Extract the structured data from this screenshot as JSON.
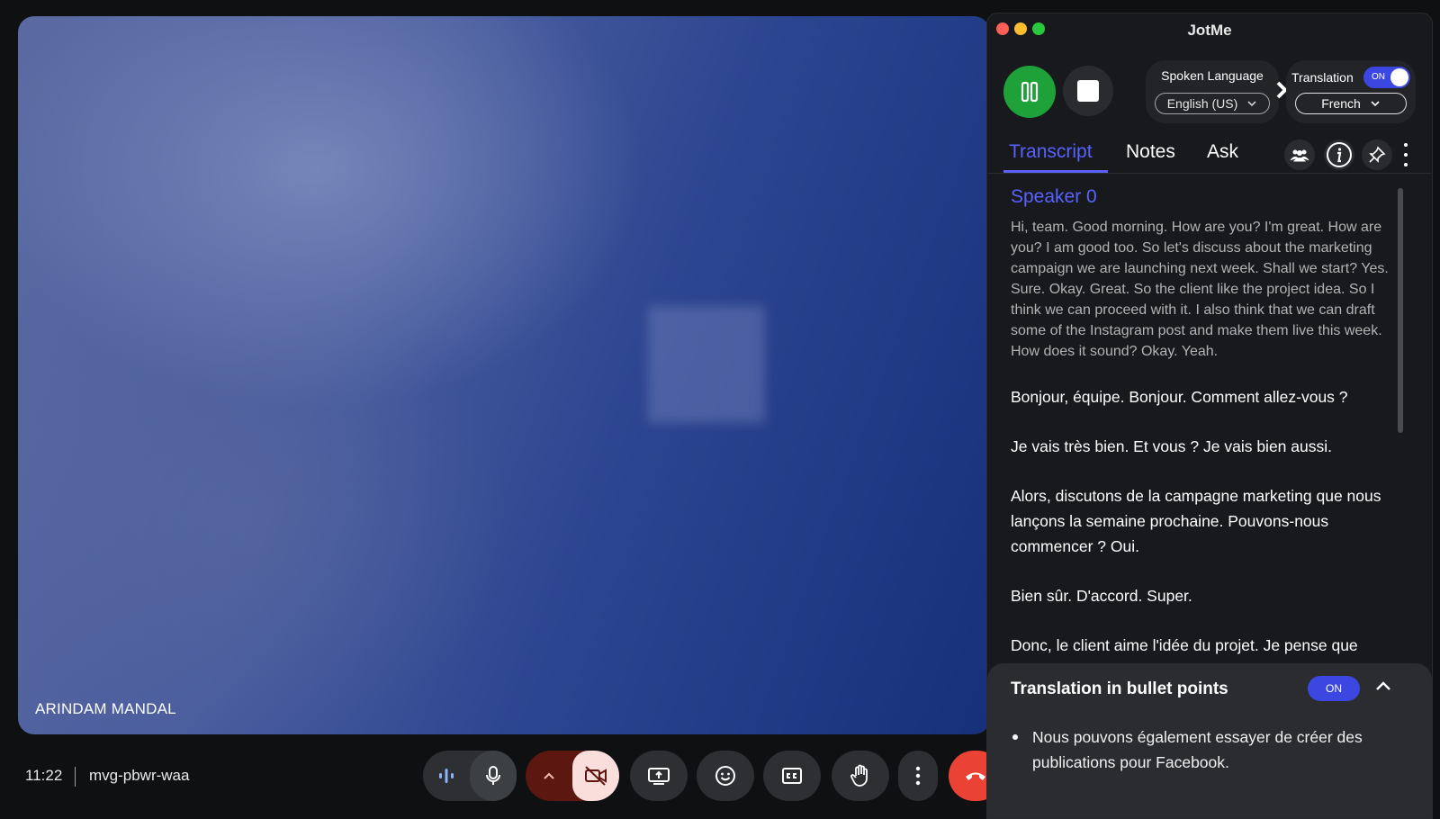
{
  "meet": {
    "participant_name": "ARINDAM MANDAL",
    "time": "11:22",
    "meeting_code": "mvg-pbwr-waa",
    "controls": {
      "audio": "sound-wave-icon",
      "mic": "microphone-icon",
      "camera_options": "chevron-up-icon",
      "camera": "camera-off-icon",
      "present": "present-screen-icon",
      "emoji": "emoji-icon",
      "captions": "captions-icon",
      "hand": "raise-hand-icon",
      "more": "more-vertical-icon",
      "end_call": "end-call-icon"
    }
  },
  "jotme": {
    "title": "JotMe",
    "spoken_language_label": "Spoken Language",
    "spoken_language_value": "English (US)",
    "translation_label": "Translation",
    "translation_toggle": "ON",
    "target_language_value": "French",
    "tabs": [
      {
        "label": "Transcript",
        "active": true
      },
      {
        "label": "Notes",
        "active": false
      },
      {
        "label": "Ask",
        "active": false
      }
    ],
    "speaker": "Speaker 0",
    "original_text": "Hi, team. Good morning. How are you? I'm great. How are you? I am good too. So let's discuss about the marketing campaign we are launching next week. Shall we start? Yes. Sure. Okay. Great. So the client like the project idea. So I think we can proceed with it. I also think that we can draft some of the Instagram post and make them live this week. How does it sound? Okay. Yeah.",
    "translated_paragraphs": [
      "Bonjour, équipe. Bonjour. Comment allez-vous ?",
      "Je vais très bien. Et vous ? Je vais bien aussi.",
      "Alors, discutons de la campagne marketing que nous lançons la semaine prochaine. Pouvons-nous commencer ? Oui.",
      "Bien sûr. D'accord. Super.",
      "Donc, le client aime l'idée du projet. Je pense que"
    ],
    "bullet_panel": {
      "title": "Translation in bullet points",
      "toggle": "ON",
      "items": [
        "Nous pouvons également essayer de créer des publications pour Facebook."
      ]
    }
  },
  "colors": {
    "accent": "#5862ff",
    "pause_green": "#1fa13a",
    "end_call_red": "#ea4335",
    "camera_off_bg": "#f9dedc"
  }
}
